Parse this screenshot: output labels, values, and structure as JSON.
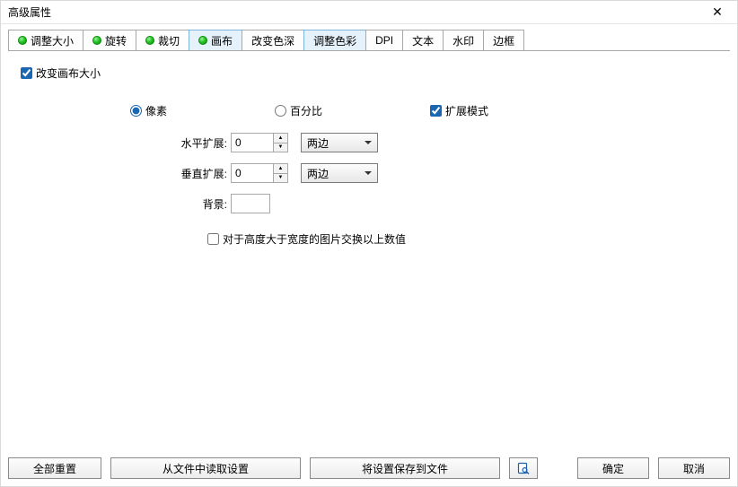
{
  "window": {
    "title": "高级属性"
  },
  "tabs": [
    {
      "label": "调整大小",
      "dot": true,
      "state": "normal"
    },
    {
      "label": "旋转",
      "dot": true,
      "state": "normal"
    },
    {
      "label": "裁切",
      "dot": true,
      "state": "normal"
    },
    {
      "label": "画布",
      "dot": true,
      "state": "active"
    },
    {
      "label": "改变色深",
      "dot": false,
      "state": "normal"
    },
    {
      "label": "调整色彩",
      "dot": false,
      "state": "highlight"
    },
    {
      "label": "DPI",
      "dot": false,
      "state": "normal"
    },
    {
      "label": "文本",
      "dot": false,
      "state": "normal"
    },
    {
      "label": "水印",
      "dot": false,
      "state": "normal"
    },
    {
      "label": "边框",
      "dot": false,
      "state": "normal"
    }
  ],
  "canvas": {
    "change_size_label": "改变画布大小",
    "change_size_checked": true,
    "unit_pixel": "像素",
    "unit_percent": "百分比",
    "unit_selected": "像素",
    "expand_mode_label": "扩展模式",
    "expand_mode_checked": true,
    "h_expand_label": "水平扩展:",
    "h_expand_value": "0",
    "h_expand_side": "两边",
    "v_expand_label": "垂直扩展:",
    "v_expand_value": "0",
    "v_expand_side": "两边",
    "bg_label": "背景:",
    "bg_color": "#ffffff",
    "swap_label": "对于高度大于宽度的图片交换以上数值",
    "swap_checked": false
  },
  "footer": {
    "reset_all": "全部重置",
    "load": "从文件中读取设置",
    "save": "将设置保存到文件",
    "preview_icon": "preview-icon",
    "ok": "确定",
    "cancel": "取消"
  }
}
